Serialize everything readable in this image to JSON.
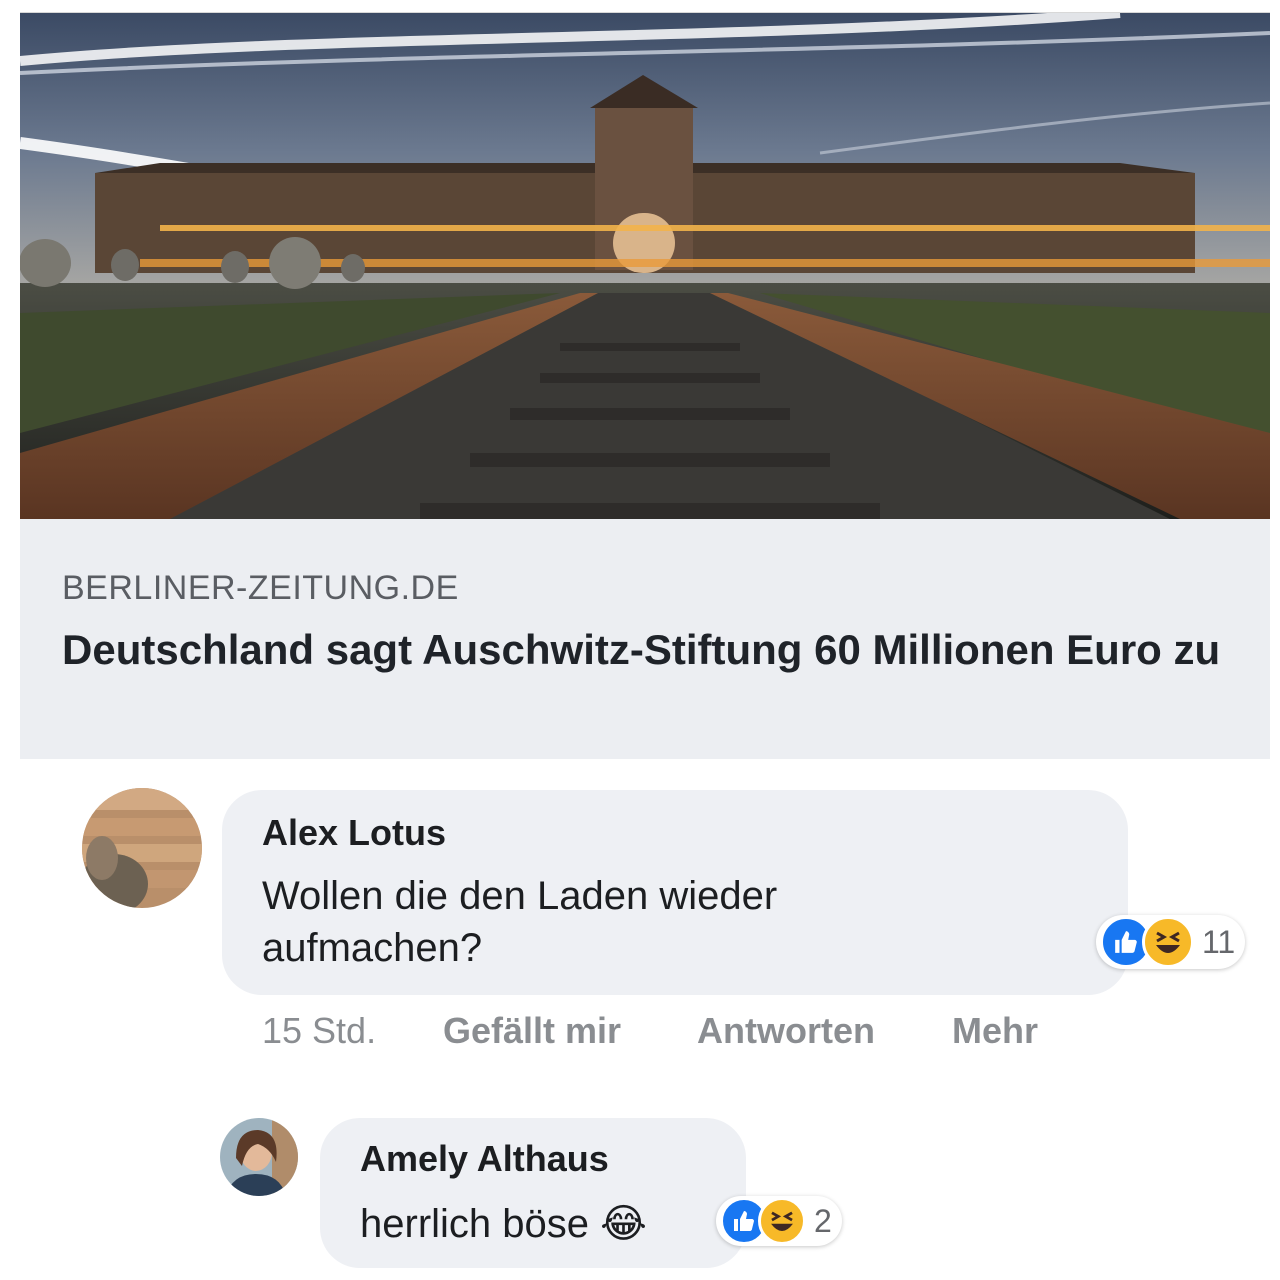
{
  "link_card": {
    "domain": "BERLINER-ZEITUNG.DE",
    "headline": "Deutschland sagt Auschwitz-Stiftung 60 Millionen Euro zu"
  },
  "comments": [
    {
      "author": "Alex Lotus",
      "text": "Wollen die den Laden wieder aufmachen?",
      "reaction_count": "11",
      "reactions": [
        "like-icon",
        "haha-icon"
      ],
      "time": "15 Std.",
      "actions": {
        "like": "Gefällt mir",
        "reply": "Antworten",
        "more": "Mehr"
      }
    },
    {
      "author": "Amely Althaus",
      "text": "herrlich böse",
      "emoji": "😂",
      "reaction_count": "2",
      "reactions": [
        "like-icon",
        "haha-icon"
      ]
    }
  ],
  "colors": {
    "like_blue": "#1877f2",
    "haha_yellow": "#f7b928",
    "bubble_bg": "#eef0f4",
    "meta_gray": "#8a8d91"
  }
}
